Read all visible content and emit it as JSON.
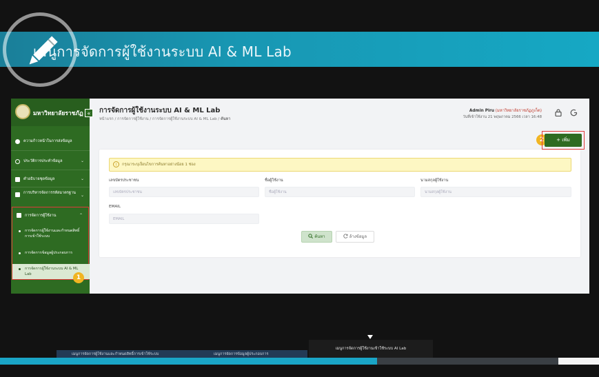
{
  "video": {
    "title": "เมนูการจัดการผู้ใช้งานระบบ AI & ML Lab",
    "progress_percent": 63,
    "chapters": [
      {
        "label": "เมนูการจัดการผู้ใช้งานและกำหนดสิทธิ์การเข้าใช้ระบบ"
      },
      {
        "label": "เมนูการจัดการข้อมูลผู้ประกอบการ"
      }
    ],
    "tooltip": "เมนูการจัดการผู้ใช้งานเข้าใช้ระบบ AI Lab",
    "accent": "#1aa5c6"
  },
  "app": {
    "brand": "มหาวิทยาลัยราชภัฏ",
    "collapse_glyph": "«",
    "colors": {
      "sidebar": "#2e6b22",
      "primary": "#2e6b22",
      "highlight": "#e03a3a",
      "badge": "#f1b522"
    },
    "sidebar": {
      "items": [
        {
          "label": "ความก้าวหน้าในการส่งข้อมูล",
          "icon": "dashboard-icon"
        },
        {
          "label": "ประวัติการประทำข้อมูล",
          "icon": "history-icon",
          "chev": "⌄"
        },
        {
          "label": "คำอธิบายชุดข้อมูล",
          "icon": "book-icon",
          "chev": "⌄"
        },
        {
          "label": "การบริหารจัดการรหัสมาตรฐาน",
          "icon": "calendar-icon",
          "chev": "⌄"
        },
        {
          "label": "การจัดการผู้ใช้งาน",
          "icon": "user-icon",
          "chev": "⌃"
        }
      ],
      "sub_items": [
        {
          "label": "การจัดการผู้ใช้งานและกำหนดสิทธิ์การเข้าใช้ระบบ"
        },
        {
          "label": "การจัดการข้อมูลผู้ประกอบการ"
        },
        {
          "label": "การจัดการผู้ใช้งานระบบ AI & ML Lab"
        }
      ],
      "badge": "1"
    },
    "header": {
      "title": "การจัดการผู้ใช้งานระบบ AI & ML Lab",
      "breadcrumb": [
        "หน้าแรก",
        "การจัดการผู้ใช้งาน",
        "การจัดการผู้ใช้งานระบบ AI & ML Lab",
        "ค้นหา"
      ],
      "separator": "/",
      "user_name": "Admin Piru",
      "user_org": "(มหาวิทยาลัยราชภัฏภูเก็ต)",
      "last_login": "วันที่เข้าใช้งาน 21 พฤษภาคม 2566 เวลา 16:48",
      "icons": [
        {
          "name": "lock-icon",
          "glyph": "🔒"
        },
        {
          "name": "logout-icon",
          "glyph": "⟳"
        }
      ]
    },
    "toolbar": {
      "add_label": "+ เพิ่ม",
      "badge": "2"
    },
    "search": {
      "alert": "กรุณาระบุเงื่อนไขการค้นหาอย่างน้อย 1 ช่อง",
      "alert_icon": "!",
      "fields": [
        {
          "label": "เลขบัตรประชาชน",
          "placeholder": "เลขบัตรประชาชน"
        },
        {
          "label": "ชื่อผู้ใช้งาน",
          "placeholder": "ชื่อผู้ใช้งาน"
        },
        {
          "label": "นามสกุลผู้ใช้งาน",
          "placeholder": "นามสกุลผู้ใช้งาน"
        },
        {
          "label": "EMAIL",
          "placeholder": "EMAIL"
        }
      ],
      "search_label": "ค้นหา",
      "clear_label": "ล้างข้อมูล"
    }
  }
}
